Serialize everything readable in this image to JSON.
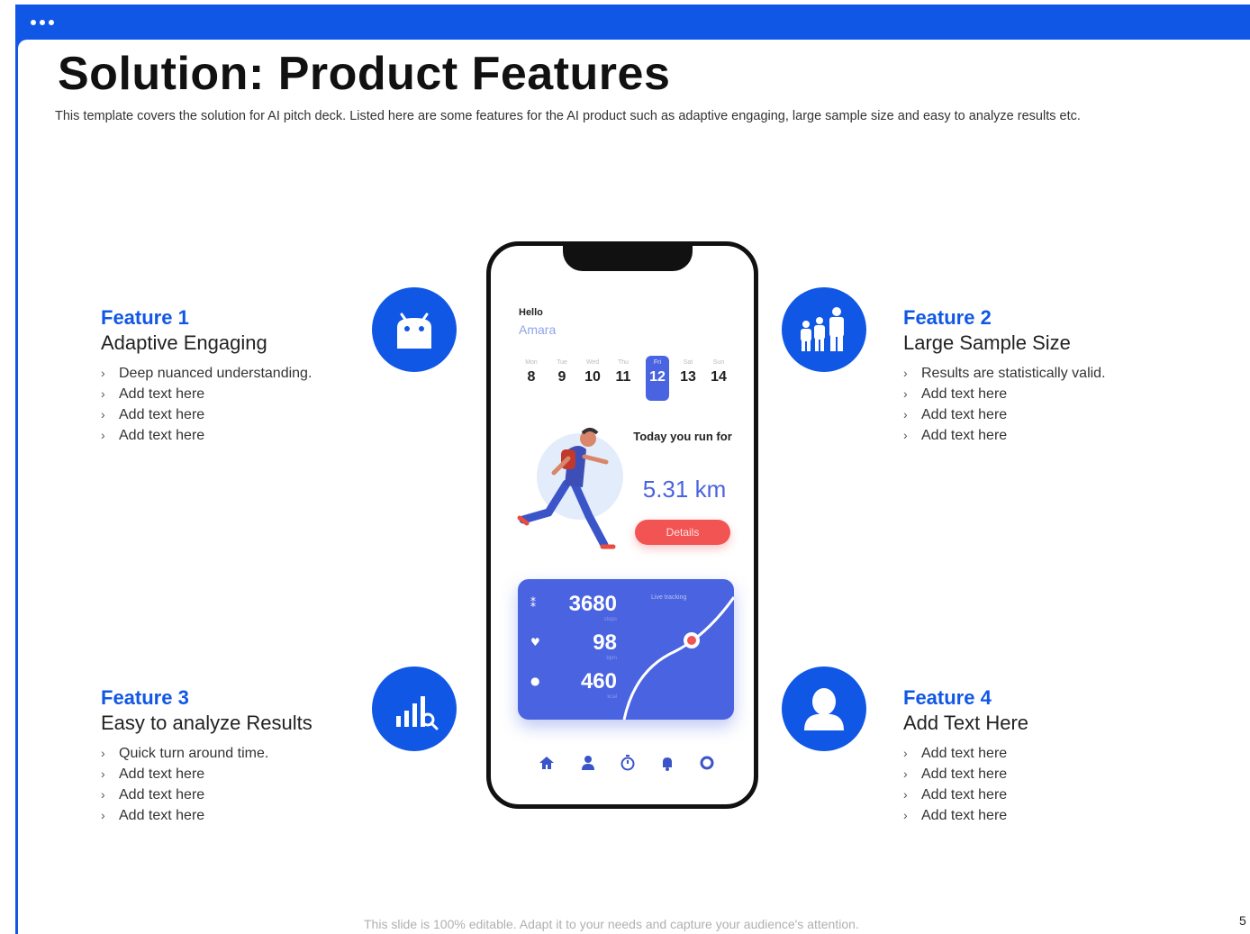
{
  "slide": {
    "title": "Solution: Product Features",
    "subtitle": "This template covers the solution for AI pitch deck. Listed here are some features for the AI product such as adaptive engaging, large sample size and easy to analyze results etc.",
    "footer": "This slide is 100% editable. Adapt it to your needs and capture your audience's attention.",
    "page_number": "5"
  },
  "colors": {
    "accent": "#1157e6",
    "phone_card": "#4a63e0",
    "details_button": "#f25353"
  },
  "features": [
    {
      "title": "Feature 1",
      "subtitle": "Adaptive Engaging",
      "icon": "android-icon",
      "bullets": [
        "Deep nuanced understanding.",
        "Add text here",
        "Add text here",
        "Add text here"
      ]
    },
    {
      "title": "Feature 2",
      "subtitle": "Large Sample Size",
      "icon": "family-icon",
      "bullets": [
        "Results are statistically valid.",
        "Add text here",
        "Add text here",
        "Add text here"
      ]
    },
    {
      "title": "Feature 3",
      "subtitle": "Easy to analyze Results",
      "icon": "chart-search-icon",
      "bullets": [
        "Quick turn around time.",
        "Add text here",
        "Add text here",
        "Add text here"
      ]
    },
    {
      "title": "Feature 4",
      "subtitle": "Add Text Here",
      "icon": "user-icon",
      "bullets": [
        "Add text here",
        "Add text here",
        "Add text here",
        "Add text here"
      ]
    }
  ],
  "phone": {
    "greeting": "Hello",
    "name": "Amara",
    "days": [
      {
        "name": "Mon",
        "num": "8"
      },
      {
        "name": "Tue",
        "num": "9"
      },
      {
        "name": "Wed",
        "num": "10"
      },
      {
        "name": "Thu",
        "num": "11"
      },
      {
        "name": "Fri",
        "num": "12"
      },
      {
        "name": "Sat",
        "num": "13"
      },
      {
        "name": "Sun",
        "num": "14"
      }
    ],
    "selected_day": "12",
    "run_label": "Today you run for",
    "distance": "5.31 km",
    "details_button": "Details",
    "stats_label": "Live tracking",
    "stats": [
      {
        "icon": "footsteps-icon",
        "value": "3680",
        "unit": "steps"
      },
      {
        "icon": "heart-icon",
        "value": "98",
        "unit": "bpm"
      },
      {
        "icon": "drop-icon",
        "value": "460",
        "unit": "kcal"
      }
    ],
    "nav": [
      "home-icon",
      "profile-icon",
      "timer-icon",
      "notification-icon",
      "settings-icon"
    ]
  }
}
